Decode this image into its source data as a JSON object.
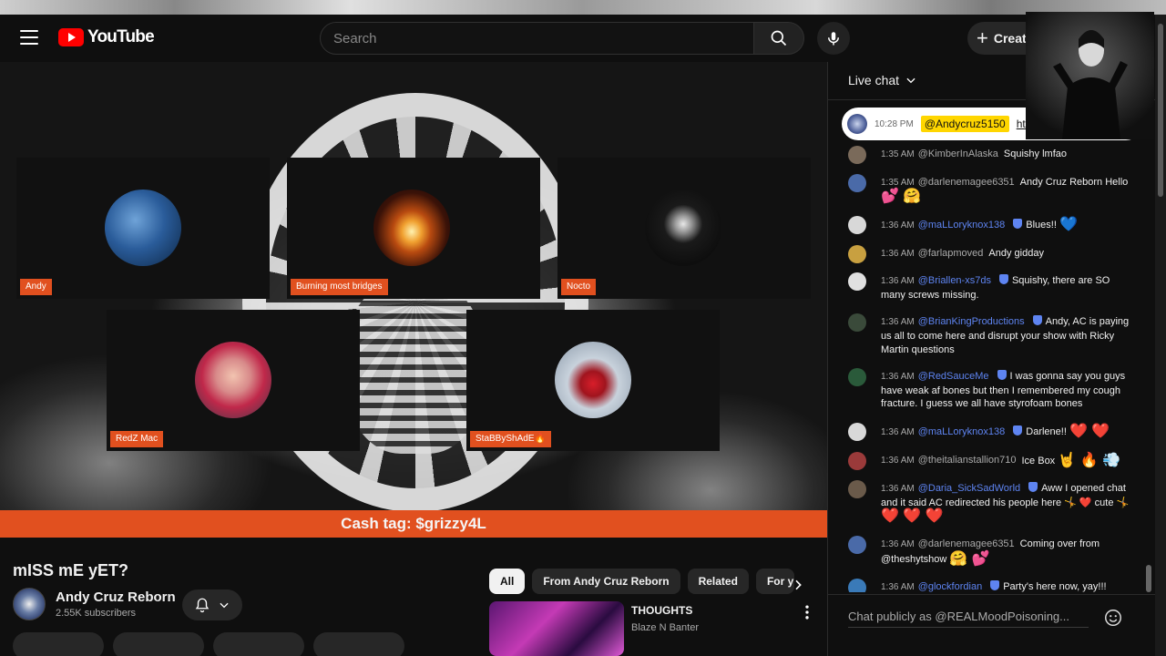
{
  "masthead": {
    "logo_text": "YouTube",
    "search_placeholder": "Search",
    "create_label": "Create"
  },
  "video": {
    "participants": [
      {
        "name": "Andy"
      },
      {
        "name": "Burning most bridges"
      },
      {
        "name": "Nocto"
      },
      {
        "name": "RedZ Mac"
      },
      {
        "name": "StaBByShAdE🔥"
      }
    ],
    "cash_tag": "Cash tag: $grizzy4L"
  },
  "info": {
    "title": "mISS mE yET?",
    "channel_name": "Andy Cruz  Reborn",
    "subscribers": "2.55K subscribers"
  },
  "chips": [
    "All",
    "From Andy Cruz Reborn",
    "Related",
    "For y"
  ],
  "recommendation": {
    "title": "THOUGHTS",
    "channel": "Blaze N Banter"
  },
  "chat": {
    "header": "Live chat",
    "pinned": {
      "time": "10:28 PM",
      "author": "@Andycruz5150",
      "link": "htt"
    },
    "messages": [
      {
        "time": "1:35 AM",
        "author": "@KimberInAlaska",
        "member": false,
        "text": "Squishy lmfao",
        "emoji": "",
        "avatar": "#7a6a5a"
      },
      {
        "time": "1:35 AM",
        "author": "@darlenemagee6351",
        "member": false,
        "text": "Andy Cruz Reborn Hello",
        "emoji": "💕 🤗",
        "avatar": "#4a6aa8"
      },
      {
        "time": "1:36 AM",
        "author": "@maLLoryknox138",
        "member": true,
        "text": "Blues!!",
        "emoji": "💙",
        "avatar": "#d8d8d8"
      },
      {
        "time": "1:36 AM",
        "author": "@farlapmoved",
        "member": false,
        "text": "Andy gidday",
        "emoji": "",
        "avatar": "#c8a040"
      },
      {
        "time": "1:36 AM",
        "author": "@Briallen-xs7ds",
        "member": true,
        "text": "Squishy, there are SO many screws missing.",
        "emoji": "",
        "avatar": "#e0e0e0"
      },
      {
        "time": "1:36 AM",
        "author": "@BrianKingProductions",
        "member": true,
        "text": "Andy, AC is paying us all to come here and disrupt your show with Ricky Martin questions",
        "emoji": "",
        "avatar": "#3a4a3a"
      },
      {
        "time": "1:36 AM",
        "author": "@RedSauceMe",
        "member": true,
        "text": "I was gonna say you guys have weak af bones but then I remembered my cough fracture. I guess we all have styrofoam bones",
        "emoji": "",
        "avatar": "#2a5a3a"
      },
      {
        "time": "1:36 AM",
        "author": "@maLLoryknox138",
        "member": true,
        "text": "Darlene!!",
        "emoji": "❤️ ❤️",
        "avatar": "#d8d8d8"
      },
      {
        "time": "1:36 AM",
        "author": "@theitalianstallion710",
        "member": false,
        "text": "Ice Box",
        "emoji": "🤘 🔥 💨",
        "avatar": "#9a3a3a"
      },
      {
        "time": "1:36 AM",
        "author": "@Daria_SickSadWorld",
        "member": true,
        "text": "Aww I opened chat and it said AC redirected his people here 🤸 ❤️ cute 🤸",
        "emoji": "❤️ ❤️ ❤️",
        "avatar": "#6a5a4a"
      },
      {
        "time": "1:36 AM",
        "author": "@darlenemagee6351",
        "member": false,
        "text": "Coming over from @theshytshow",
        "emoji": "🤗 💕",
        "avatar": "#4a6aa8"
      },
      {
        "time": "1:36 AM",
        "author": "@glockfordian",
        "member": true,
        "text": "Party's here now, yay!!!",
        "emoji": "",
        "avatar": "#3a7ab8"
      }
    ],
    "input_placeholder": "Chat publicly as @REALMoodPoisoning..."
  },
  "colors": {
    "accent_orange": "#e1501f",
    "member_blue": "#5e84f1",
    "pinned_tag": "#ffd600"
  }
}
